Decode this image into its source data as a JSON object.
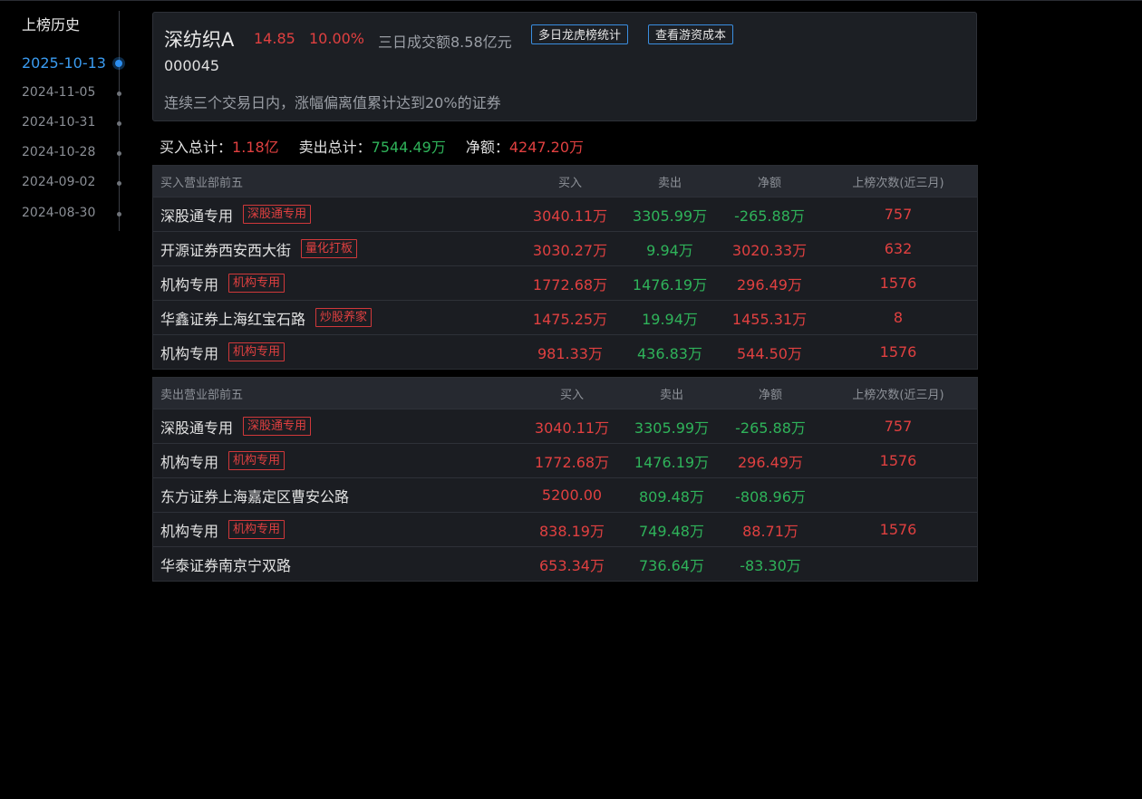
{
  "sidebar": {
    "title": "上榜历史",
    "dates": [
      {
        "label": "2025-10-13",
        "active": true
      },
      {
        "label": "2024-11-05",
        "active": false
      },
      {
        "label": "2024-10-31",
        "active": false
      },
      {
        "label": "2024-10-28",
        "active": false
      },
      {
        "label": "2024-09-02",
        "active": false
      },
      {
        "label": "2024-08-30",
        "active": false
      }
    ]
  },
  "header": {
    "name": "深纺织A",
    "price": "14.85",
    "change": "10.00%",
    "volume": "三日成交额8.58亿元",
    "btn_multi": "多日龙虎榜统计",
    "btn_cost": "查看游资成本",
    "code": "000045",
    "reason": "连续三个交易日内，涨幅偏离值累计达到20%的证券"
  },
  "summary": {
    "buy_label": "买入总计：",
    "buy_value": "1.18亿",
    "sell_label": "卖出总计：",
    "sell_value": "7544.49万",
    "net_label": "净额：",
    "net_value": "4247.20万"
  },
  "buy_table": {
    "headers": {
      "name": "买入营业部前五",
      "buy": "买入",
      "sell": "卖出",
      "net": "净额",
      "count": "上榜次数(近三月)"
    },
    "rows": [
      {
        "name": "深股通专用",
        "tag": "深股通专用",
        "buy": "3040.11万",
        "sell": "3305.99万",
        "net": "-265.88万",
        "count": "757"
      },
      {
        "name": "开源证券西安西大街",
        "tag": "量化打板",
        "buy": "3030.27万",
        "sell": "9.94万",
        "net": "3020.33万",
        "count": "632"
      },
      {
        "name": "机构专用",
        "tag": "机构专用",
        "buy": "1772.68万",
        "sell": "1476.19万",
        "net": "296.49万",
        "count": "1576"
      },
      {
        "name": "华鑫证券上海红宝石路",
        "tag": "炒股养家",
        "buy": "1475.25万",
        "sell": "19.94万",
        "net": "1455.31万",
        "count": "8"
      },
      {
        "name": "机构专用",
        "tag": "机构专用",
        "buy": "981.33万",
        "sell": "436.83万",
        "net": "544.50万",
        "count": "1576"
      }
    ]
  },
  "sell_table": {
    "headers": {
      "name": "卖出营业部前五",
      "buy": "买入",
      "sell": "卖出",
      "net": "净额",
      "count": "上榜次数(近三月)"
    },
    "rows": [
      {
        "name": "深股通专用",
        "tag": "深股通专用",
        "buy": "3040.11万",
        "sell": "3305.99万",
        "net": "-265.88万",
        "count": "757"
      },
      {
        "name": "机构专用",
        "tag": "机构专用",
        "buy": "1772.68万",
        "sell": "1476.19万",
        "net": "296.49万",
        "count": "1576"
      },
      {
        "name": "东方证券上海嘉定区曹安公路",
        "tag": "",
        "buy": "5200.00",
        "sell": "809.48万",
        "net": "-808.96万",
        "count": ""
      },
      {
        "name": "机构专用",
        "tag": "机构专用",
        "buy": "838.19万",
        "sell": "749.48万",
        "net": "88.71万",
        "count": "1576"
      },
      {
        "name": "华泰证券南京宁双路",
        "tag": "",
        "buy": "653.34万",
        "sell": "736.64万",
        "net": "-83.30万",
        "count": ""
      }
    ]
  },
  "colors": {
    "up": "#e04040",
    "down": "#2fb35a",
    "accent": "#2c8ef0",
    "background": "#000000",
    "card": "#1c1f24"
  }
}
